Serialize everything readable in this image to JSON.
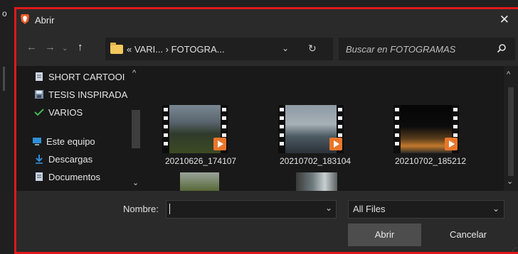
{
  "window": {
    "title": "Abrir",
    "close_icon": "close-icon"
  },
  "nav": {
    "back_icon": "back-arrow-icon",
    "forward_icon": "forward-arrow-icon",
    "recent_icon": "chevron-down-icon",
    "up_icon": "up-arrow-icon"
  },
  "address": {
    "path": "« VARI...  ›  FOTOGRA...",
    "dropdown_icon": "chevron-down-icon",
    "refresh_icon": "refresh-icon"
  },
  "search": {
    "placeholder": "Buscar en FOTOGRAMAS",
    "icon": "search-icon"
  },
  "sidebar": {
    "items": [
      {
        "label": "SHORT CARTOOI",
        "icon": "document-icon"
      },
      {
        "label": "TESIS INSPIRADA",
        "icon": "folder-icon"
      },
      {
        "label": "VARIOS",
        "icon": "checkmark-icon"
      },
      {
        "label": "Este equipo",
        "icon": "computer-icon"
      },
      {
        "label": "Descargas",
        "icon": "download-icon"
      },
      {
        "label": "Documentos",
        "icon": "document-icon"
      }
    ]
  },
  "files": [
    {
      "name": "20210626_174107"
    },
    {
      "name": "20210702_183104"
    },
    {
      "name": "20210702_185212"
    }
  ],
  "footer": {
    "filename_label": "Nombre:",
    "filename_value": "",
    "filetype": "All Files",
    "open_label": "Abrir",
    "cancel_label": "Cancelar"
  },
  "colors": {
    "accent_border": "#e0191b",
    "folder": "#f2c75c",
    "video_badge": "#e9762b"
  }
}
